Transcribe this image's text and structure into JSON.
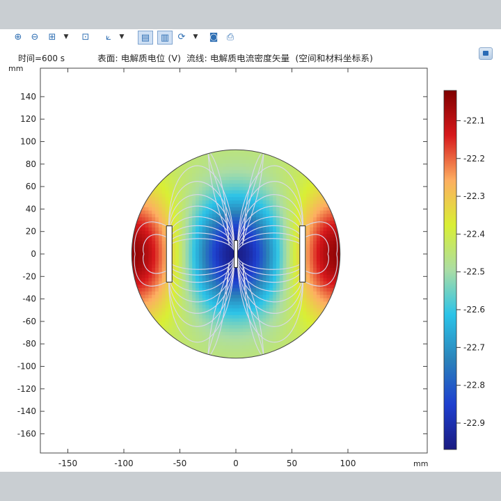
{
  "toolbar": {
    "icons": [
      "zoom-in-icon",
      "zoom-out-icon",
      "zoom-box-icon",
      "zoom-extents-icon",
      "axis-orientation-icon",
      "plot-view-icon",
      "table-view-icon",
      "rotate-icon",
      "camera-icon",
      "print-icon"
    ]
  },
  "header": {
    "time_label": "时间=600 s",
    "plot_title": "表面: 电解质电位 (V)  流线: 电解质电流密度矢量  (空间和材料坐标系)"
  },
  "chart_data": {
    "type": "heatmap",
    "title": "表面: 电解质电位 (V)  流线: 电解质电流密度矢量  (空间和材料坐标系)",
    "time": "时间=600 s",
    "x_unit": "mm",
    "y_unit": "mm",
    "xlim": [
      -175,
      175
    ],
    "ylim": [
      -180,
      162
    ],
    "xticks": [
      -150,
      -100,
      -50,
      0,
      50,
      100
    ],
    "yticks": [
      140,
      120,
      100,
      80,
      60,
      40,
      20,
      0,
      -20,
      -40,
      -60,
      -80,
      -100,
      -120,
      -140,
      -160
    ],
    "domain": {
      "shape": "circle",
      "center": [
        0,
        0
      ],
      "radius": 93
    },
    "electrodes": [
      {
        "name": "left",
        "x": [
          -62,
          -57
        ],
        "y": [
          -25,
          25
        ]
      },
      {
        "name": "center",
        "x": [
          -1.5,
          1.5
        ],
        "y": [
          -12,
          12
        ]
      },
      {
        "name": "right",
        "x": [
          57,
          62
        ],
        "y": [
          -25,
          25
        ]
      }
    ],
    "field": {
      "min": -22.97,
      "max": -22.02,
      "unit": "V"
    },
    "colorbar": {
      "ticks": [
        -22.1,
        -22.2,
        -22.3,
        -22.4,
        -22.5,
        -22.6,
        -22.7,
        -22.8,
        -22.9
      ],
      "range": [
        -22.97,
        -22.02
      ],
      "colormap": [
        "#7f0000",
        "#d7191c",
        "#fdae61",
        "#d9ef34",
        "#abdda4",
        "#2bc3e8",
        "#2b83ba",
        "#1e3fcf",
        "#1a1a80"
      ]
    },
    "streamline_color": "#d9d9ec"
  }
}
